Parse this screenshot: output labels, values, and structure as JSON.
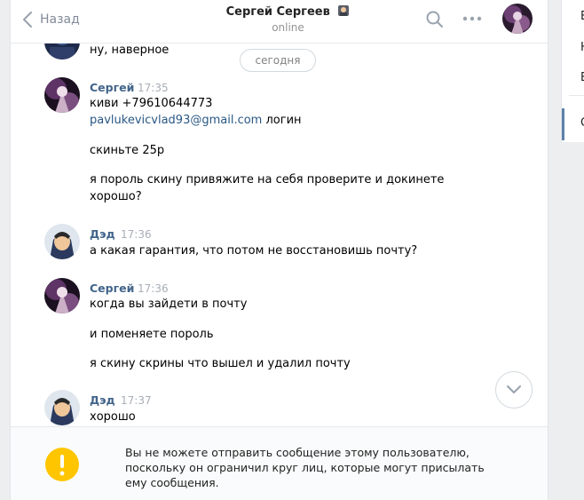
{
  "header": {
    "back_label": "Назад",
    "title": "Сергей Сергеев",
    "status": "online"
  },
  "date_divider": "сегодня",
  "messages": [
    {
      "author": "",
      "time": "",
      "lines": [
        "ну, наверное"
      ]
    },
    {
      "author": "Сергей",
      "time": "17:35",
      "lines": [
        "киви +79610644773",
        "pavlukevicvlad93@gmail.com",
        " логин",
        "скиньте 25р",
        "я пороль скину привяжите на себя проверите и докинете",
        "хорошо?"
      ]
    },
    {
      "author": "Дэд",
      "time": "17:36",
      "lines": [
        "а какая гарантия, что потом не восстановишь почту?"
      ]
    },
    {
      "author": "Сергей",
      "time": "17:36",
      "lines": [
        "когда вы зайдети в почту",
        "и поменяете пороль",
        "я скину скрины что вышел и удалил почту"
      ]
    },
    {
      "author": "Дэд",
      "time": "17:37",
      "lines": [
        "хорошо"
      ]
    }
  ],
  "footer": {
    "notice": "Вы не можете отправить сообщение этому пользователю, поскольку он ограничил круг лиц, которые могут присылать ему сообщения."
  },
  "right_panel": {
    "letters": [
      "В",
      "Н",
      "В",
      "С"
    ]
  },
  "colors": {
    "link": "#2a5885",
    "author": "#42648b",
    "warning": "#ffc600"
  },
  "icons": [
    "chevron-left-icon",
    "emoji-icon",
    "search-icon",
    "more-icon",
    "chevron-down-icon",
    "exclamation-icon"
  ]
}
